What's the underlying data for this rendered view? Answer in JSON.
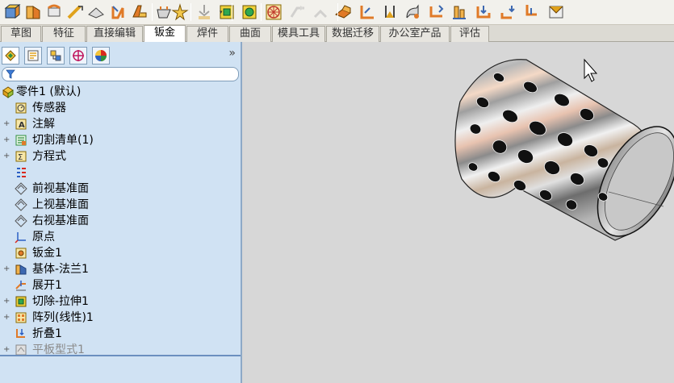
{
  "toolbar": {
    "buttons": [
      {
        "name": "view-orientation-icon"
      },
      {
        "name": "base-flange-icon"
      },
      {
        "name": "miter-flange-icon"
      },
      {
        "name": "sketched-bend-icon"
      },
      {
        "name": "hem-icon"
      },
      {
        "name": "jog-icon"
      },
      {
        "name": "edge-flange-icon"
      },
      {
        "name": "insert-bends-icon"
      },
      {
        "name": "convert-to-sheet-metal-icon"
      },
      {
        "name": "lofted-bend-icon"
      },
      {
        "name": "extruded-cut-icon"
      },
      {
        "name": "simple-hole-icon"
      },
      {
        "name": "vent-icon"
      },
      {
        "name": "unfold-icon"
      },
      {
        "name": "fold-icon"
      },
      {
        "name": "flatten-icon"
      },
      {
        "name": "no-bends-icon"
      },
      {
        "name": "rip-icon"
      },
      {
        "name": "break-corner-icon"
      },
      {
        "name": "welded-corner-icon"
      },
      {
        "name": "forming-tool-icon"
      },
      {
        "name": "closed-corner-icon"
      },
      {
        "name": "corner-relief-icon"
      },
      {
        "name": "cross-break-icon"
      },
      {
        "name": "tab-slot-icon"
      }
    ]
  },
  "tabs": [
    "草图",
    "特征",
    "直接编辑",
    "钣金",
    "焊件",
    "曲面",
    "模具工具",
    "数据迁移",
    "办公室产品",
    "评估"
  ],
  "active_tab": "钣金",
  "panel": {
    "tabs": [
      "feature-manager-icon",
      "property-manager-icon",
      "configuration-manager-icon",
      "dimxpert-icon",
      "display-manager-icon"
    ],
    "collapse_label": "»",
    "tree": [
      {
        "label": "零件1 (默认)",
        "icon": "part-icon",
        "expand": ""
      },
      {
        "label": "传感器",
        "icon": "sensor-icon",
        "expand": ""
      },
      {
        "label": "注解",
        "icon": "annotation-icon",
        "expand": "+"
      },
      {
        "label": "切割清单(1)",
        "icon": "cut-list-icon",
        "expand": "+"
      },
      {
        "label": "方程式",
        "icon": "equation-icon",
        "expand": "+"
      },
      {
        "label": "",
        "icon": "material-icon",
        "expand": ""
      },
      {
        "label": "前视基准面",
        "icon": "plane-icon",
        "expand": ""
      },
      {
        "label": "上视基准面",
        "icon": "plane-icon",
        "expand": ""
      },
      {
        "label": "右视基准面",
        "icon": "plane-icon",
        "expand": ""
      },
      {
        "label": "原点",
        "icon": "origin-icon",
        "expand": ""
      },
      {
        "label": "钣金1",
        "icon": "sheet-metal-icon",
        "expand": ""
      },
      {
        "label": "基体-法兰1",
        "icon": "base-flange-icon",
        "expand": "+"
      },
      {
        "label": "展开1",
        "icon": "unfold-icon",
        "expand": ""
      },
      {
        "label": "切除-拉伸1",
        "icon": "extruded-cut-icon",
        "expand": "+"
      },
      {
        "label": "阵列(线性)1",
        "icon": "linear-pattern-icon",
        "expand": "+"
      },
      {
        "label": "折叠1",
        "icon": "fold-icon",
        "expand": ""
      },
      {
        "label": "平板型式1",
        "icon": "flat-pattern-icon",
        "expand": "+"
      }
    ]
  },
  "colors": {
    "panel_bg": "#d0e2f3",
    "viewport_bg": "#d7d7d7",
    "accent": "#e8b21c"
  }
}
